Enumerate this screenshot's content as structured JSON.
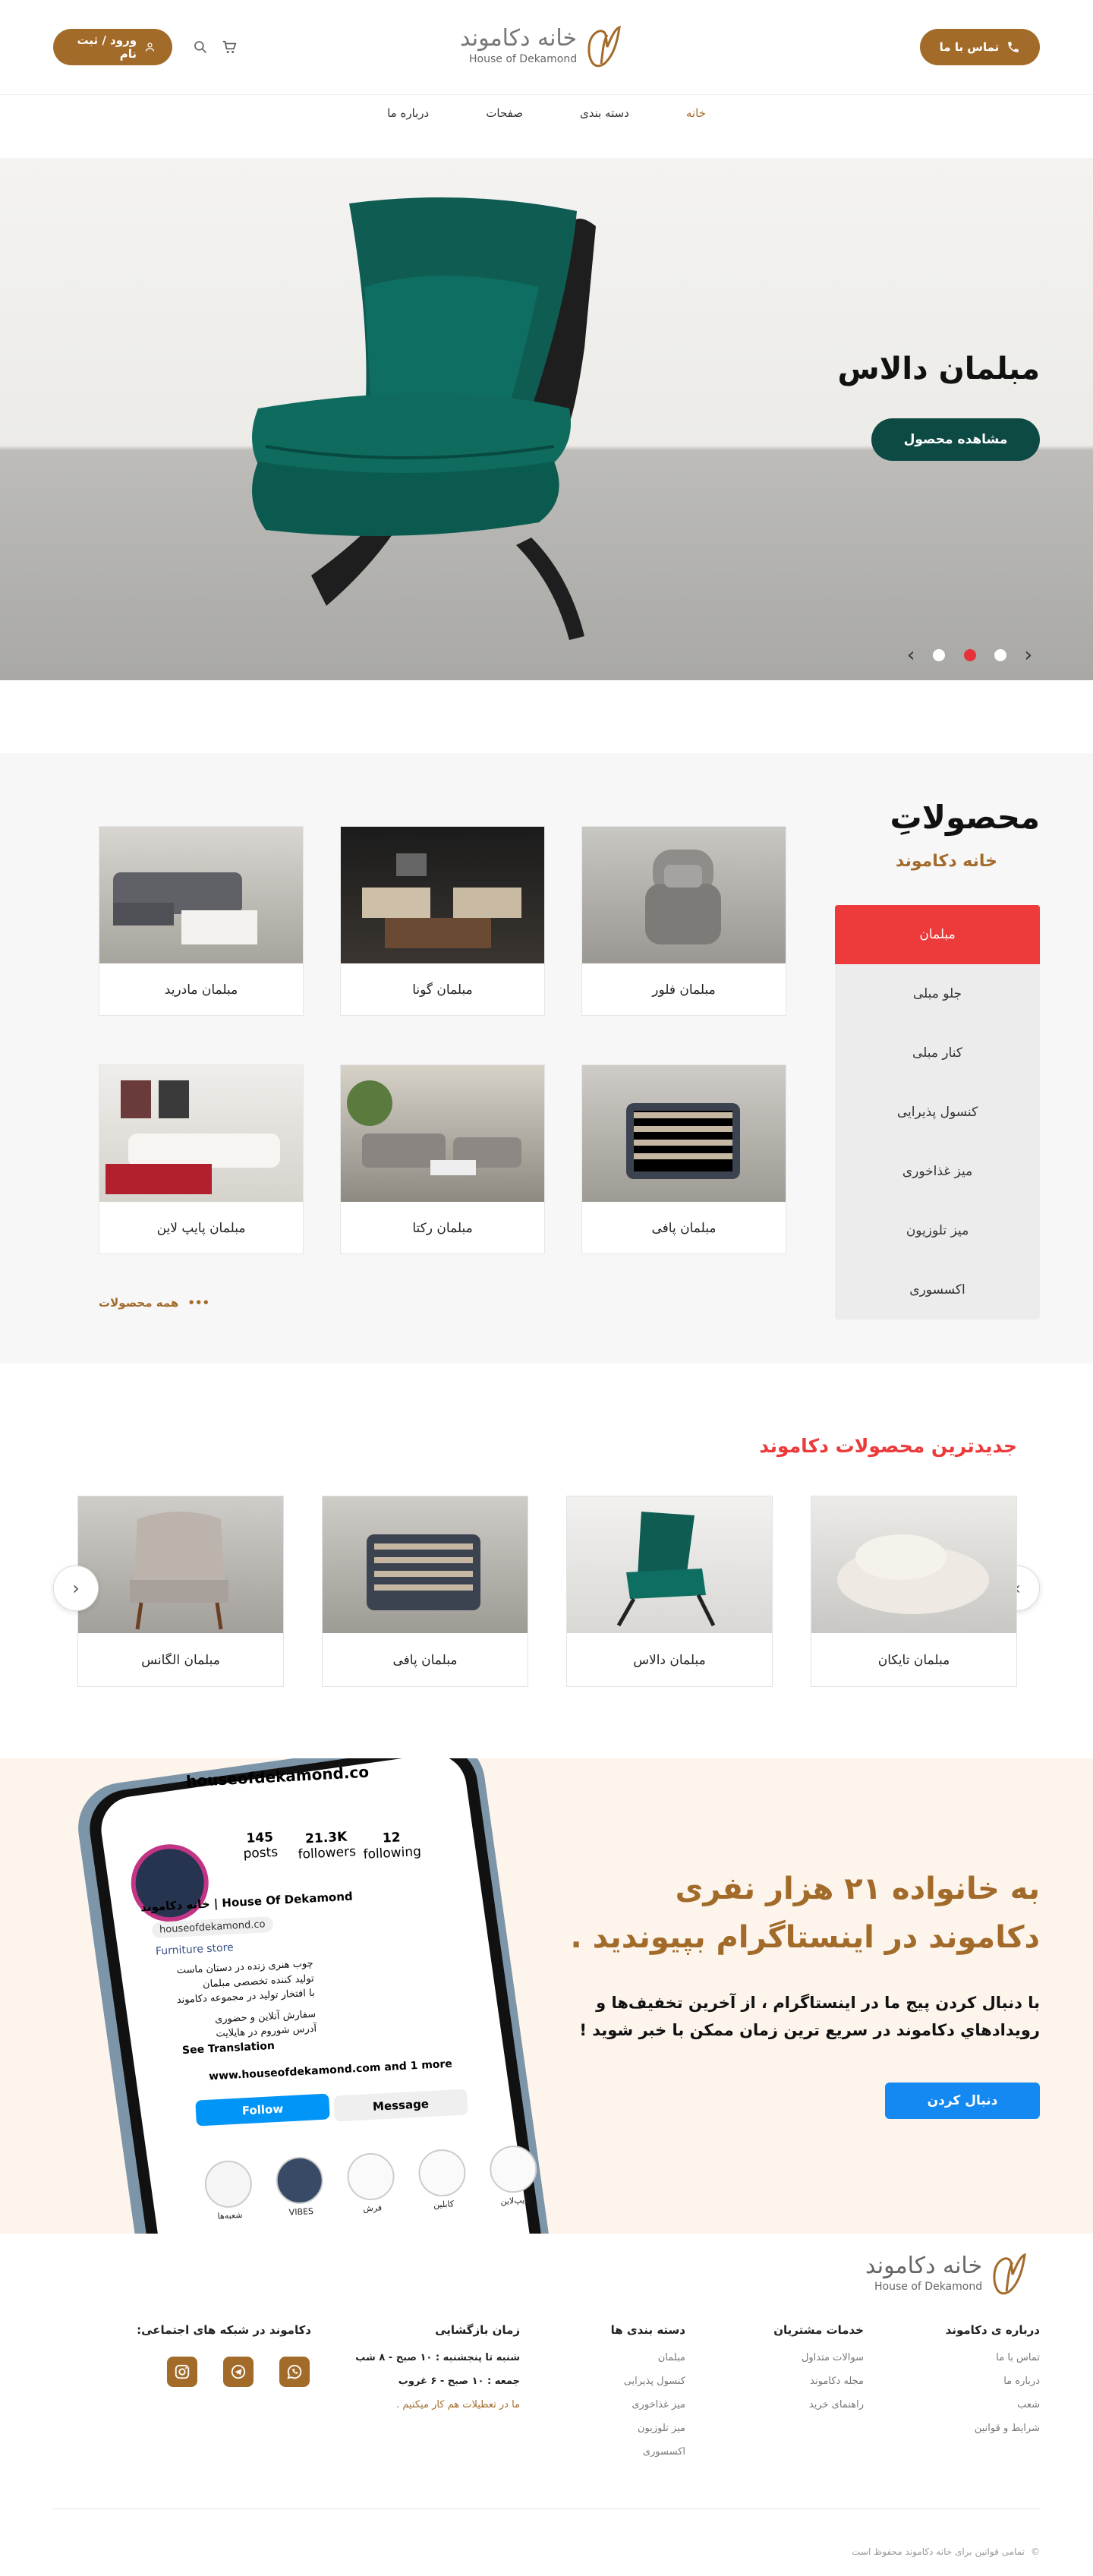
{
  "header": {
    "contact_label": "تماس با ما",
    "login_label": "ورود / ثبت نام",
    "logo_fa": "خانه دکاموند",
    "logo_en": "House of Dekamond",
    "nav": [
      "خانه",
      "دسته بندی",
      "صفحات",
      "درباره ما"
    ]
  },
  "hero": {
    "title": "مبلمان دالاس",
    "cta": "مشاهده محصول",
    "slides_count": 3,
    "active_slide": 2
  },
  "products": {
    "title": "محصولاتِ",
    "subtitle": "خانه دکاموند",
    "categories": [
      "مبلمان",
      "جلو مبلی",
      "کنار مبلی",
      "کنسول پذیرایی",
      "میز غذاخوری",
      "میز تلوزیون",
      "اکسسوری"
    ],
    "items": [
      "مبلمان فلور",
      "مبلمان گونا",
      "مبلمان مادرید",
      "مبلمان پافی",
      "مبلمان رکتا",
      "مبلمان پایپ لاین"
    ],
    "more": "همه محصولات"
  },
  "newest": {
    "title": "جدیدترین محصولات دکاموند",
    "items": [
      "مبلمان تایکان",
      "مبلمان دالاس",
      "مبلمان پافی",
      "مبلمان الگانس"
    ]
  },
  "instagram": {
    "heading": "به خانواده ۲۱ هزار نفری دکاموند در اینستاگرام بپیوندید .",
    "text": "با دنبال کردن پیج ما در اینستاگرام ، از آخرین تخفیف‌ها و رویدادهاي دکاموند در سریع ترین زمان ممکن با خبر شوید !",
    "button": "دنبال کردن",
    "phone": {
      "username": "houseofdekamond.co",
      "posts": "145",
      "posts_label": "posts",
      "followers": "21.3K",
      "followers_label": "followers",
      "following": "12",
      "following_label": "following",
      "name": "House Of Dekamond | خانه دکاموند",
      "handle": "houseofdekamond.co",
      "category": "Furniture store",
      "bio1": "چوب هنری زنده در دستان ماست",
      "bio2": "تولید کننده تخصصی مبلمان",
      "bio3": "با افتخار تولید در مجموعه دکاموند",
      "bio4": "سفارش آنلاین و حضوری",
      "bio5": "آدرس شوروم در هایلایت",
      "see_translation": "See Translation",
      "link": "www.houseofdekamond.com and 1 more",
      "follow": "Follow",
      "message": "Message",
      "highlights": [
        "شعبه‌ها",
        "VIBES",
        "فرش",
        "کابلین",
        "پایپ‌لاین"
      ]
    }
  },
  "footer": {
    "about": {
      "title": "درباره ی دکاموند",
      "items": [
        "تماس با ما",
        "درباره ما",
        "شعب",
        "شرایط و قوانین"
      ]
    },
    "services": {
      "title": "خدمات مشتریان",
      "items": [
        "سوالات متداول",
        "مجله دکاموند",
        "راهنمای خرید"
      ]
    },
    "categories": {
      "title": "دسته بندی ها",
      "items": [
        "مبلمان",
        "کنسول پذیرایی",
        "میز غذاخوری",
        "میز تلوزیون",
        "اکسسوری"
      ]
    },
    "hours": {
      "title": "زمان بازگشایی",
      "line1": "شنبه تا پنجشنبه : ۱۰ صبح - ۸ شب",
      "line2": "جمعه : ۱۰ صبح - ۶ غروب",
      "note": "ما در تعطیلات هم کار میکنیم ."
    },
    "social": {
      "title": "دکاموند در شبکه های اجتماعی:"
    },
    "copyright": "تمامی قوانین برای خانه دکاموند محفوظ است"
  },
  "colors": {
    "brand": "#A36B2A",
    "accent_red": "#ED3A3A",
    "hero_cta": "#0E4A44",
    "follow_blue": "#1489F2"
  }
}
